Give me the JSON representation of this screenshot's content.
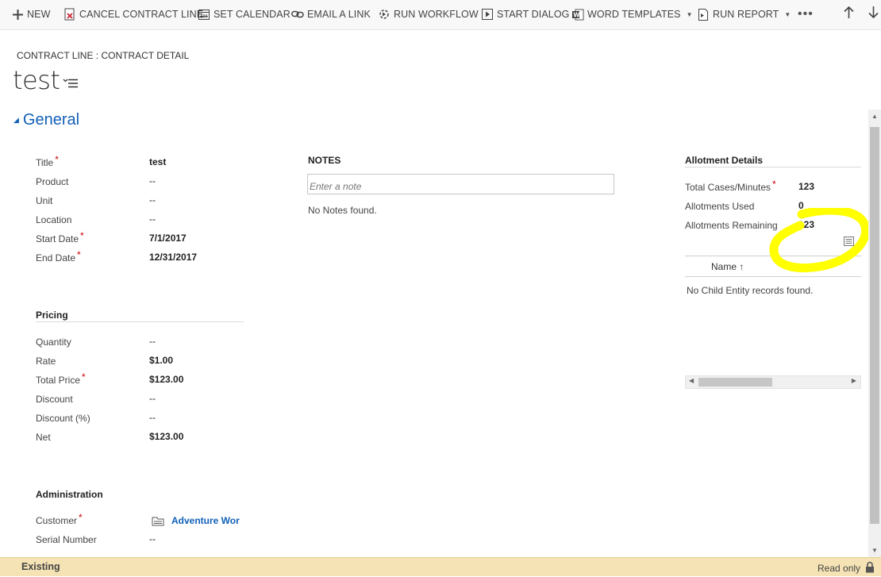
{
  "toolbar": {
    "new": "NEW",
    "cancel_contract_line": "CANCEL CONTRACT LINE",
    "set_calendar": "SET CALENDAR",
    "email_a_link": "EMAIL A LINK",
    "run_workflow": "RUN WORKFLOW",
    "start_dialog": "START DIALOG",
    "word_templates": "WORD TEMPLATES",
    "run_report": "RUN REPORT",
    "more": "•••"
  },
  "header": {
    "breadcrumb": "CONTRACT LINE : CONTRACT DETAIL",
    "title": "test"
  },
  "section": {
    "title": "General"
  },
  "general_fields": [
    {
      "label": "Title",
      "value": "test",
      "required": true
    },
    {
      "label": "Product",
      "value": "--",
      "required": false
    },
    {
      "label": "Unit",
      "value": "--",
      "required": false
    },
    {
      "label": "Location",
      "value": "--",
      "required": false
    },
    {
      "label": "Start Date",
      "value": "7/1/2017",
      "required": true
    },
    {
      "label": "End Date",
      "value": "12/31/2017",
      "required": true
    }
  ],
  "pricing": {
    "title": "Pricing",
    "fields": [
      {
        "label": "Quantity",
        "value": "--",
        "required": false
      },
      {
        "label": "Rate",
        "value": "$1.00",
        "required": false
      },
      {
        "label": "Total Price",
        "value": "$123.00",
        "required": true
      },
      {
        "label": "Discount",
        "value": "--",
        "required": false
      },
      {
        "label": "Discount (%)",
        "value": "--",
        "required": false
      },
      {
        "label": "Net",
        "value": "$123.00",
        "required": false
      }
    ]
  },
  "administration": {
    "title": "Administration",
    "customer_label": "Customer",
    "customer_value": "Adventure Wor",
    "serial_label": "Serial Number",
    "serial_value": "--"
  },
  "notes": {
    "title": "NOTES",
    "placeholder": "Enter a note",
    "empty": "No Notes found."
  },
  "allotment": {
    "title": "Allotment Details",
    "fields": [
      {
        "label": "Total Cases/Minutes",
        "value": "123",
        "required": true
      },
      {
        "label": "Allotments Used",
        "value": "0",
        "required": false
      },
      {
        "label": "Allotments Remaining",
        "value": "123",
        "required": false
      }
    ],
    "grid_column": "Name ↑",
    "grid_empty": "No Child Entity records found."
  },
  "status": {
    "state": "Existing",
    "mode": "Read only"
  },
  "colors": {
    "accent": "#1160b7",
    "required": "#cc0000",
    "status_bar": "#f5e3b5",
    "highlight": "#ffff00"
  }
}
